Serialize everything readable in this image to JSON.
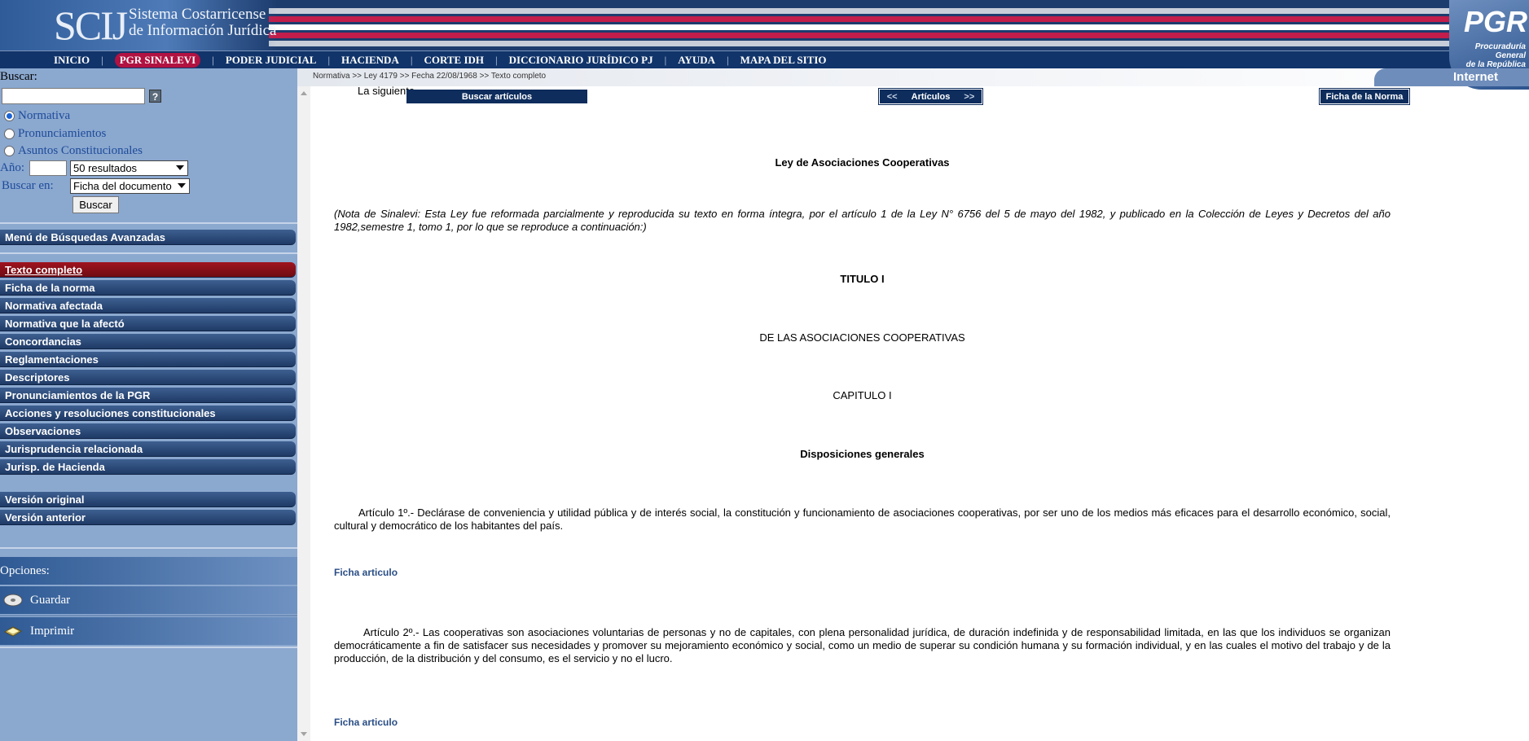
{
  "banner": {
    "logo_mark": "SCIJ",
    "logo_line1": "Sistema Costarricense",
    "logo_line2": "de Información Jurídica",
    "pgr_logo": "PGR",
    "pgr_sub1": "Procuraduría General",
    "pgr_sub2": "de la República",
    "internet": "Internet"
  },
  "nav": [
    "INICIO",
    "PGR SINALEVI",
    "PODER JUDICIAL",
    "HACIENDA",
    "CORTE IDH",
    "DICCIONARIO JURÍDICO PJ",
    "AYUDA",
    "MAPA DEL SITIO"
  ],
  "breadcrumb": "Normativa >> Ley 4179 >> Fecha 22/08/1968 >> Texto completo",
  "search": {
    "label": "Buscar:",
    "value": "",
    "help": "?",
    "radios": [
      {
        "label": "Normativa",
        "checked": true
      },
      {
        "label": "Pronunciamientos",
        "checked": false
      },
      {
        "label": "Asuntos Constitucionales",
        "checked": false
      }
    ],
    "year_label": "Año:",
    "year_value": "",
    "results_select": "50 resultados",
    "search_in_label": "Buscar en:",
    "search_in_select": "Ficha del documento",
    "button": "Buscar"
  },
  "sidebar": {
    "advanced": "Menú de Búsquedas Avanzadas",
    "items": [
      {
        "label": "Texto completo",
        "active": true
      },
      {
        "label": "Ficha de la norma"
      },
      {
        "label": "Normativa afectada"
      },
      {
        "label": "Normativa que la afectó"
      },
      {
        "label": "Concordancias"
      },
      {
        "label": "Reglamentaciones"
      },
      {
        "label": "Descriptores"
      },
      {
        "label": "Pronunciamientos de la PGR"
      },
      {
        "label": "Acciones y resoluciones constitucionales"
      },
      {
        "label": "Observaciones"
      },
      {
        "label": "Jurisprudencia relacionada"
      },
      {
        "label": "Jurisp. de Hacienda"
      }
    ],
    "versions": [
      "Versión original",
      "Versión anterior"
    ],
    "options_label": "Opciones:",
    "options": [
      "Guardar",
      "Imprimir"
    ]
  },
  "content": {
    "btn_buscar_articulos": "Buscar artículos",
    "btn_articulos_prev": "<<",
    "btn_articulos_label": "Artículos",
    "btn_articulos_next": ">>",
    "btn_ficha_norma": "Ficha de la Norma",
    "clipped_text": "La siguiente",
    "law_title": "Ley de Asociaciones Cooperativas",
    "note": "(Nota de Sinalevi: Esta Ley fue reformada parcialmente y reproducida su texto en forma íntegra, por el artículo 1 de la Ley N° 6756  del 5 de mayo del 1982, y publicado en la Colección de Leyes y Decretos del año 1982,semestre 1,  tomo 1, por lo que se reproduce a continuación:)",
    "titulo": "TITULO I",
    "titulo_name": "DE LAS ASOCIACIONES COOPERATIVAS",
    "capitulo": "CAPITULO I",
    "capitulo_name": "Disposiciones generales",
    "art1": "Artículo 1º.- Declárase de conveniencia y utilidad pública y de interés social, la constitución y funcionamiento de asociaciones cooperativas, por ser uno de los medios más eficaces para el desarrollo económico, social, cultural y democrático de los habitantes del país.",
    "ficha_articulo": "Ficha articulo",
    "art2": "Artículo 2º.- Las cooperativas son asociaciones voluntarias de personas y no de capitales, con plena personalidad jurídica, de duración indefinida y de responsabilidad limitada, en las que los individuos se organizan democráticamente a fin de satisfacer sus necesidades y promover su mejoramiento económico y social, como un medio de superar su condición humana y su formación individual, y en las cuales el motivo del trabajo y de la producción, de la distribución y del consumo, es el servicio y no el lucro."
  }
}
